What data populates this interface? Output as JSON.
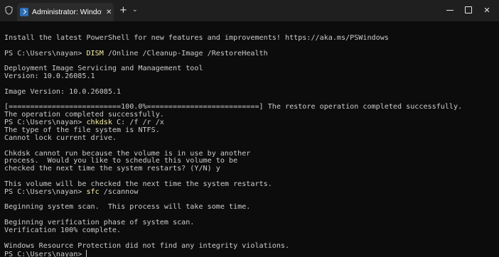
{
  "tab": {
    "title": "Administrator: Windows PowerShell",
    "close_glyph": "✕",
    "new_tab_glyph": "+",
    "dropdown_glyph": "⌄"
  },
  "window_controls": {
    "minimize": "minimize-icon",
    "maximize": "maximize-icon",
    "close": "✕"
  },
  "colors": {
    "background": "#0c0c0c",
    "titlebar": "#1f1f1f",
    "text": "#cccccc",
    "command": "#f9f1a5"
  },
  "terminal": {
    "lines": [
      {
        "text": ""
      },
      {
        "text": "Install the latest PowerShell for new features and improvements! https://aka.ms/PSWindows"
      },
      {
        "text": ""
      },
      {
        "prompt": "PS C:\\Users\\nayan> ",
        "cmd": "DISM",
        "args": " /Online /Cleanup-Image /RestoreHealth"
      },
      {
        "text": ""
      },
      {
        "text": "Deployment Image Servicing and Management tool"
      },
      {
        "text": "Version: 10.0.26085.1"
      },
      {
        "text": ""
      },
      {
        "text": "Image Version: 10.0.26085.1"
      },
      {
        "text": ""
      },
      {
        "text": "[==========================100.0%==========================] The restore operation completed successfully."
      },
      {
        "text": "The operation completed successfully."
      },
      {
        "prompt": "PS C:\\Users\\nayan> ",
        "cmd": "chkdsk",
        "args": " C: /f /r /x"
      },
      {
        "text": "The type of the file system is NTFS."
      },
      {
        "text": "Cannot lock current drive."
      },
      {
        "text": ""
      },
      {
        "text": "Chkdsk cannot run because the volume is in use by another"
      },
      {
        "text": "process.  Would you like to schedule this volume to be"
      },
      {
        "text": "checked the next time the system restarts? (Y/N) y"
      },
      {
        "text": ""
      },
      {
        "text": "This volume will be checked the next time the system restarts."
      },
      {
        "prompt": "PS C:\\Users\\nayan> ",
        "cmd": "sfc",
        "args": " /scannow"
      },
      {
        "text": ""
      },
      {
        "text": "Beginning system scan.  This process will take some time."
      },
      {
        "text": ""
      },
      {
        "text": "Beginning verification phase of system scan."
      },
      {
        "text": "Verification 100% complete."
      },
      {
        "text": ""
      },
      {
        "text": "Windows Resource Protection did not find any integrity violations."
      },
      {
        "prompt": "PS C:\\Users\\nayan> ",
        "cursor": true
      }
    ]
  }
}
